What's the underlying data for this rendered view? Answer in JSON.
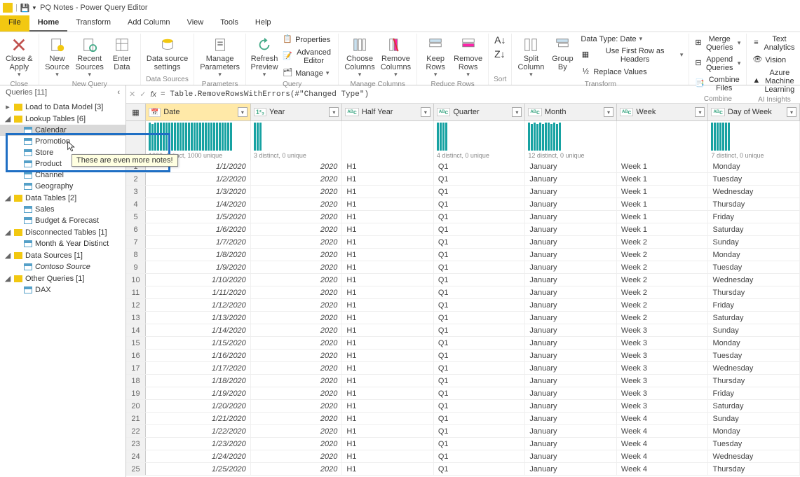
{
  "title": "PQ Notes - Power Query Editor",
  "menu": {
    "file": "File",
    "home": "Home",
    "transform": "Transform",
    "addcol": "Add Column",
    "view": "View",
    "tools": "Tools",
    "help": "Help"
  },
  "ribbon": {
    "close": {
      "btn": "Close &\nApply",
      "title": "Close"
    },
    "newquery": {
      "new": "New\nSource",
      "recent": "Recent\nSources",
      "enter": "Enter\nData",
      "title": "New Query"
    },
    "datasources": {
      "settings": "Data source\nsettings",
      "title": "Data Sources"
    },
    "parameters": {
      "manage": "Manage\nParameters",
      "title": "Parameters"
    },
    "query": {
      "refresh": "Refresh\nPreview",
      "props": "Properties",
      "adv": "Advanced Editor",
      "manage": "Manage",
      "title": "Query"
    },
    "manage_cols": {
      "choose": "Choose\nColumns",
      "remove": "Remove\nColumns",
      "title": "Manage Columns"
    },
    "reduce_rows": {
      "keep": "Keep\nRows",
      "remove": "Remove\nRows",
      "title": "Reduce Rows"
    },
    "sort": {
      "title": "Sort"
    },
    "transform": {
      "split": "Split\nColumn",
      "group": "Group\nBy",
      "datatype": "Data Type: Date",
      "firstrow": "Use First Row as Headers",
      "replace": "Replace Values",
      "title": "Transform"
    },
    "combine": {
      "merge": "Merge Queries",
      "append": "Append Queries",
      "combine": "Combine Files",
      "title": "Combine"
    },
    "ai": {
      "text": "Text Analytics",
      "vision": "Vision",
      "ml": "Azure Machine Learning",
      "title": "AI Insights"
    }
  },
  "queries": {
    "header": "Queries [11]",
    "groups": [
      {
        "name": "Load to Data Model [3]",
        "expanded": false
      },
      {
        "name": "Lookup Tables [6]",
        "expanded": true,
        "items": [
          {
            "name": "Calendar",
            "selected": true
          },
          {
            "name": "Promotion"
          },
          {
            "name": "Store"
          },
          {
            "name": "Product"
          },
          {
            "name": "Channel"
          },
          {
            "name": "Geography"
          }
        ]
      },
      {
        "name": "Data Tables [2]",
        "expanded": true,
        "items": [
          {
            "name": "Sales"
          },
          {
            "name": "Budget & Forecast"
          }
        ]
      },
      {
        "name": "Disconnected Tables [1]",
        "expanded": true,
        "items": [
          {
            "name": "Month & Year Distinct"
          }
        ]
      },
      {
        "name": "Data Sources [1]",
        "expanded": true,
        "items": [
          {
            "name": "Contoso Source",
            "italic": true
          }
        ]
      },
      {
        "name": "Other Queries [1]",
        "expanded": true,
        "items": [
          {
            "name": "DAX"
          }
        ]
      }
    ]
  },
  "tooltip": "These are even more notes!",
  "formula": "= Table.RemoveRowsWithErrors(#\"Changed Type\")",
  "columns": [
    {
      "field": "date",
      "label": "Date",
      "type": "date",
      "w": "w-date",
      "dist": "1000 distinct, 1000 unique",
      "align": "right",
      "bars": [
        40,
        38,
        40,
        40,
        40,
        40,
        40,
        40,
        40,
        40,
        40,
        40,
        40,
        40,
        40,
        40,
        40,
        40,
        40,
        40,
        40,
        40,
        40,
        40,
        40,
        40,
        40,
        40,
        40,
        40
      ]
    },
    {
      "field": "year",
      "label": "Year",
      "type": "int",
      "w": "w-year",
      "dist": "3 distinct, 0 unique",
      "align": "right",
      "bars": [
        40,
        40,
        40
      ]
    },
    {
      "field": "half",
      "label": "Half Year",
      "type": "abc",
      "w": "w-half",
      "dist": "",
      "align": "left",
      "bars": []
    },
    {
      "field": "qtr",
      "label": "Quarter",
      "type": "abc",
      "w": "w-qtr",
      "dist": "4 distinct, 0 unique",
      "align": "left",
      "bars": [
        40,
        40,
        40,
        40
      ]
    },
    {
      "field": "month",
      "label": "Month",
      "type": "abc",
      "w": "w-month",
      "dist": "12 distinct, 0 unique",
      "align": "left",
      "bars": [
        40,
        38,
        40,
        38,
        40,
        38,
        40,
        40,
        38,
        40,
        38,
        40
      ]
    },
    {
      "field": "week",
      "label": "Week",
      "type": "abc",
      "w": "w-week",
      "dist": "",
      "align": "left",
      "bars": []
    },
    {
      "field": "dow",
      "label": "Day of Week",
      "type": "abc",
      "w": "w-dow",
      "dist": "7 distinct, 0 unique",
      "align": "left",
      "bars": [
        40,
        40,
        40,
        40,
        40,
        40,
        40
      ]
    }
  ],
  "rows": [
    {
      "n": 1,
      "date": "1/1/2020",
      "year": "2020",
      "half": "H1",
      "qtr": "Q1",
      "month": "January",
      "week": "Week 1",
      "dow": "Monday"
    },
    {
      "n": 2,
      "date": "1/2/2020",
      "year": "2020",
      "half": "H1",
      "qtr": "Q1",
      "month": "January",
      "week": "Week 1",
      "dow": "Tuesday"
    },
    {
      "n": 3,
      "date": "1/3/2020",
      "year": "2020",
      "half": "H1",
      "qtr": "Q1",
      "month": "January",
      "week": "Week 1",
      "dow": "Wednesday"
    },
    {
      "n": 4,
      "date": "1/4/2020",
      "year": "2020",
      "half": "H1",
      "qtr": "Q1",
      "month": "January",
      "week": "Week 1",
      "dow": "Thursday"
    },
    {
      "n": 5,
      "date": "1/5/2020",
      "year": "2020",
      "half": "H1",
      "qtr": "Q1",
      "month": "January",
      "week": "Week 1",
      "dow": "Friday"
    },
    {
      "n": 6,
      "date": "1/6/2020",
      "year": "2020",
      "half": "H1",
      "qtr": "Q1",
      "month": "January",
      "week": "Week 1",
      "dow": "Saturday"
    },
    {
      "n": 7,
      "date": "1/7/2020",
      "year": "2020",
      "half": "H1",
      "qtr": "Q1",
      "month": "January",
      "week": "Week 2",
      "dow": "Sunday"
    },
    {
      "n": 8,
      "date": "1/8/2020",
      "year": "2020",
      "half": "H1",
      "qtr": "Q1",
      "month": "January",
      "week": "Week 2",
      "dow": "Monday"
    },
    {
      "n": 9,
      "date": "1/9/2020",
      "year": "2020",
      "half": "H1",
      "qtr": "Q1",
      "month": "January",
      "week": "Week 2",
      "dow": "Tuesday"
    },
    {
      "n": 10,
      "date": "1/10/2020",
      "year": "2020",
      "half": "H1",
      "qtr": "Q1",
      "month": "January",
      "week": "Week 2",
      "dow": "Wednesday"
    },
    {
      "n": 11,
      "date": "1/11/2020",
      "year": "2020",
      "half": "H1",
      "qtr": "Q1",
      "month": "January",
      "week": "Week 2",
      "dow": "Thursday"
    },
    {
      "n": 12,
      "date": "1/12/2020",
      "year": "2020",
      "half": "H1",
      "qtr": "Q1",
      "month": "January",
      "week": "Week 2",
      "dow": "Friday"
    },
    {
      "n": 13,
      "date": "1/13/2020",
      "year": "2020",
      "half": "H1",
      "qtr": "Q1",
      "month": "January",
      "week": "Week 2",
      "dow": "Saturday"
    },
    {
      "n": 14,
      "date": "1/14/2020",
      "year": "2020",
      "half": "H1",
      "qtr": "Q1",
      "month": "January",
      "week": "Week 3",
      "dow": "Sunday"
    },
    {
      "n": 15,
      "date": "1/15/2020",
      "year": "2020",
      "half": "H1",
      "qtr": "Q1",
      "month": "January",
      "week": "Week 3",
      "dow": "Monday"
    },
    {
      "n": 16,
      "date": "1/16/2020",
      "year": "2020",
      "half": "H1",
      "qtr": "Q1",
      "month": "January",
      "week": "Week 3",
      "dow": "Tuesday"
    },
    {
      "n": 17,
      "date": "1/17/2020",
      "year": "2020",
      "half": "H1",
      "qtr": "Q1",
      "month": "January",
      "week": "Week 3",
      "dow": "Wednesday"
    },
    {
      "n": 18,
      "date": "1/18/2020",
      "year": "2020",
      "half": "H1",
      "qtr": "Q1",
      "month": "January",
      "week": "Week 3",
      "dow": "Thursday"
    },
    {
      "n": 19,
      "date": "1/19/2020",
      "year": "2020",
      "half": "H1",
      "qtr": "Q1",
      "month": "January",
      "week": "Week 3",
      "dow": "Friday"
    },
    {
      "n": 20,
      "date": "1/20/2020",
      "year": "2020",
      "half": "H1",
      "qtr": "Q1",
      "month": "January",
      "week": "Week 3",
      "dow": "Saturday"
    },
    {
      "n": 21,
      "date": "1/21/2020",
      "year": "2020",
      "half": "H1",
      "qtr": "Q1",
      "month": "January",
      "week": "Week 4",
      "dow": "Sunday"
    },
    {
      "n": 22,
      "date": "1/22/2020",
      "year": "2020",
      "half": "H1",
      "qtr": "Q1",
      "month": "January",
      "week": "Week 4",
      "dow": "Monday"
    },
    {
      "n": 23,
      "date": "1/23/2020",
      "year": "2020",
      "half": "H1",
      "qtr": "Q1",
      "month": "January",
      "week": "Week 4",
      "dow": "Tuesday"
    },
    {
      "n": 24,
      "date": "1/24/2020",
      "year": "2020",
      "half": "H1",
      "qtr": "Q1",
      "month": "January",
      "week": "Week 4",
      "dow": "Wednesday"
    },
    {
      "n": 25,
      "date": "1/25/2020",
      "year": "2020",
      "half": "H1",
      "qtr": "Q1",
      "month": "January",
      "week": "Week 4",
      "dow": "Thursday"
    }
  ]
}
